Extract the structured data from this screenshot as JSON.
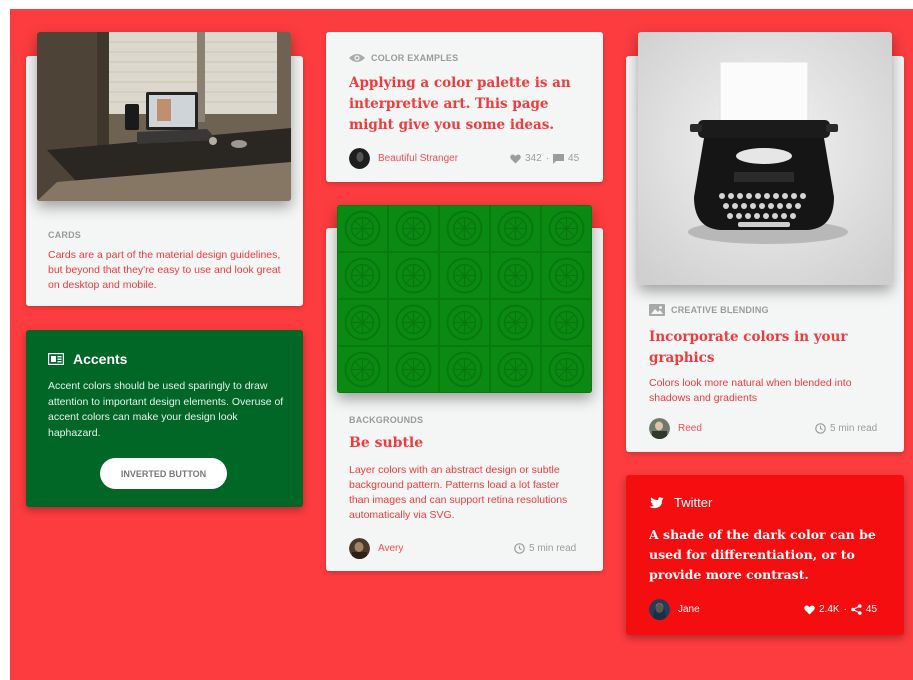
{
  "cards_card": {
    "overline": "CARDS",
    "body": "Cards are a part of the material design guidelines, but beyond that they're easy to use and look great on desktop and mobile."
  },
  "accents_card": {
    "title": "Accents",
    "icon": "newspaper-icon",
    "body": "Accent colors should be used sparingly to draw attention to important design elements. Overuse of accent colors can make your design look haphazard.",
    "button_label": "INVERTED BUTTON"
  },
  "color_examples_card": {
    "overline": "COLOR EXAMPLES",
    "icon": "eye-icon",
    "headline": "Applying a color palette is an interpretive art. This page might give you some ideas.",
    "author": "Beautiful Stranger",
    "likes": "342",
    "separator": "·",
    "comments": "45"
  },
  "backgrounds_card": {
    "overline": "BACKGROUNDS",
    "headline": "Be subtle",
    "body": "Layer colors with an abstract design or subtle background pattern. Patterns load a lot faster than images and can support retina resolutions automatically via SVG.",
    "author": "Avery",
    "read_time": "5 min read"
  },
  "creative_card": {
    "overline": "CREATIVE BLENDING",
    "icon": "image-icon",
    "headline": "Incorporate colors in your graphics",
    "body": "Colors look more natural when blended into shadows and gradients",
    "author": "Reed",
    "read_time": "5 min read"
  },
  "twitter_card": {
    "label": "Twitter",
    "icon": "twitter-icon",
    "quote": "A shade of the dark color can be used for differentiation, or to provide more contrast.",
    "author": "Jane",
    "likes": "2.4K",
    "separator": "·",
    "shares": "45"
  },
  "colors": {
    "background": "#fc3c3f",
    "card": "#f4f5f5",
    "accent_green": "#016727",
    "pattern_green": "#0a8a12",
    "twitter_red": "#f40e0f"
  }
}
